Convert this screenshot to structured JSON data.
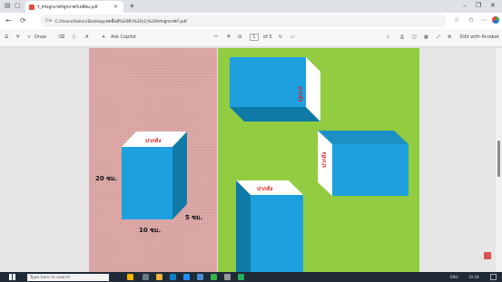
{
  "browser": {
    "tab_title": "ร_ทรงลูกบาศก์ลูกบาศก์เหลี่ยม.pdf",
    "tab_close": "×",
    "new_tab": "+",
    "window_controls": [
      "–",
      "❐",
      "✕"
    ],
    "address_prefix": "File",
    "url": "C:/Users/Admin/Desktop/ลดพื้นที่%20ผิว%20(1)%20ทรงลูกบาศก์.pdf",
    "nav": [
      "←",
      "⟳"
    ]
  },
  "pdf_toolbar": {
    "draw": "Draw",
    "ask_copilot": "Ask Copilot",
    "zoom_out": "−",
    "zoom_in": "+",
    "page_current": "1",
    "page_total": "of 5",
    "edit_acrobat": "Edit with Acrobat"
  },
  "figures": {
    "box1_top_label": "ปากถัง",
    "box1_height": "20 ซม.",
    "box1_depth": "5 ซม.",
    "box1_width": "10 ซม.",
    "box2_label": "ปากถัง",
    "box3_label": "ปากถัง",
    "box4_label": "ปากถัง"
  },
  "taskbar": {
    "search_placeholder": "Type here to search",
    "tray_text": "ENG",
    "time": "10:18"
  },
  "colors": {
    "left_page": "#dca8a7",
    "right_page": "#92cc40",
    "box_front": "#1da0dd",
    "box_side": "#0f7aa7",
    "label_red": "#e0191a"
  }
}
